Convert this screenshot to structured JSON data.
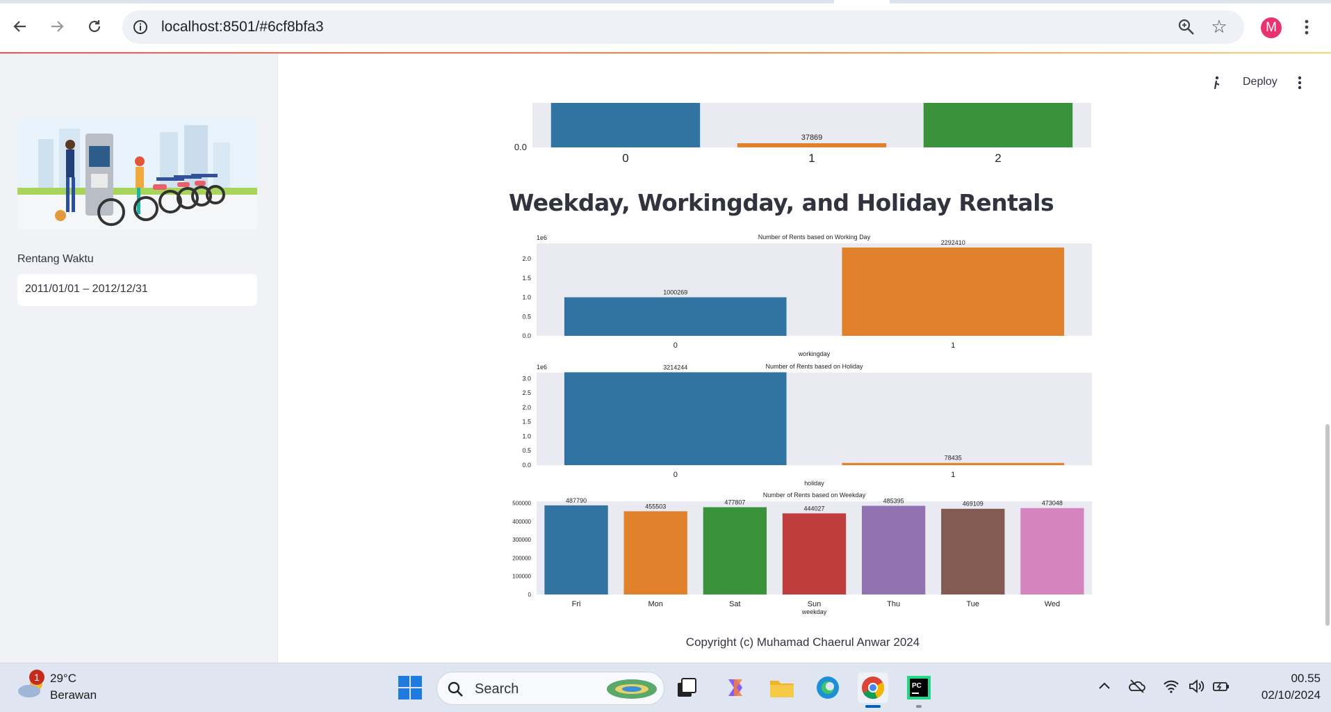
{
  "browser": {
    "url": "localhost:8501/#6cf8bfa3",
    "avatar_letter": "M"
  },
  "app": {
    "deploy_label": "Deploy",
    "section_title": "Weekday, Workingday, and Holiday Rentals",
    "copyright": "Copyright (c) Muhamad Chaerul Anwar 2024"
  },
  "sidebar": {
    "date_label": "Rentang Waktu",
    "date_range_value": "2011/01/01 – 2012/12/31"
  },
  "taskbar": {
    "weather_badge": "1",
    "temperature": "29°C",
    "condition": "Berawan",
    "search_placeholder": "Search",
    "time": "00.55",
    "date": "02/10/2024"
  },
  "colors": {
    "blue": "#3274a1",
    "orange": "#e1812c",
    "green": "#3a923a",
    "red": "#c03d3e",
    "purple": "#9372b2",
    "brown": "#845b53",
    "pink": "#d684bd",
    "plot_bg": "#eaeaf2"
  },
  "chart_data": [
    {
      "type": "bar",
      "title": "",
      "categories": [
        "0",
        "1",
        "2"
      ],
      "values": [
        null,
        37869,
        null
      ],
      "data_labels": [
        "",
        "37869",
        ""
      ],
      "ytick_labels": [
        "0.0"
      ],
      "note": "partially visible (cropped at top)"
    },
    {
      "type": "bar",
      "title": "Number of Rents based on Working Day",
      "xlabel": "workingday",
      "ylabel": "",
      "scale_label": "1e6",
      "categories": [
        "0",
        "1"
      ],
      "values": [
        1000269,
        2292410
      ],
      "ylim": [
        0,
        2.4
      ],
      "ytick_labels": [
        "0.0",
        "0.5",
        "1.0",
        "1.5",
        "2.0"
      ]
    },
    {
      "type": "bar",
      "title": "Number of Rents based on Holiday",
      "xlabel": "holiday",
      "ylabel": "",
      "scale_label": "1e6",
      "categories": [
        "0",
        "1"
      ],
      "values": [
        3214244,
        78435
      ],
      "ylim": [
        0,
        3.2
      ],
      "ytick_labels": [
        "0.0",
        "0.5",
        "1.0",
        "1.5",
        "2.0",
        "2.5",
        "3.0"
      ]
    },
    {
      "type": "bar",
      "title": "Number of Rents based on Weekday",
      "xlabel": "weekday",
      "ylabel": "",
      "categories": [
        "Fri",
        "Mon",
        "Sat",
        "Sun",
        "Thu",
        "Tue",
        "Wed"
      ],
      "values": [
        487790,
        455503,
        477807,
        444027,
        485395,
        469109,
        473048
      ],
      "ylim": [
        0,
        510000
      ],
      "ytick_labels": [
        "0",
        "100000",
        "200000",
        "300000",
        "400000",
        "500000"
      ]
    }
  ]
}
